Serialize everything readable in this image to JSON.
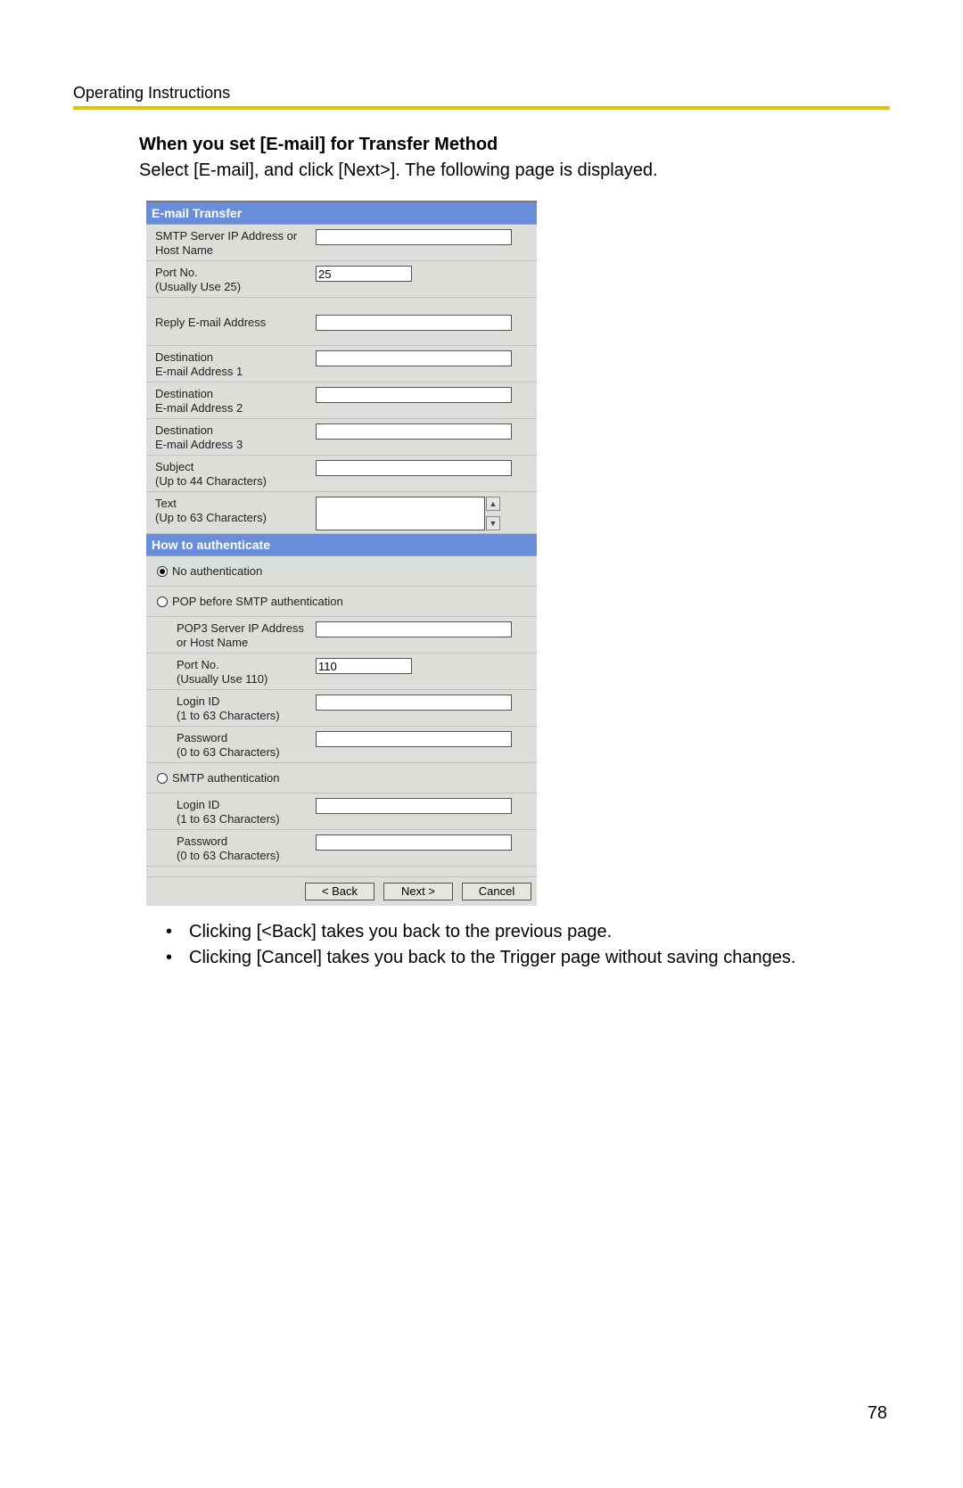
{
  "header": "Operating Instructions",
  "title": "When you set [E-mail] for Transfer Method",
  "description": "Select [E-mail], and click [Next>]. The following page is displayed.",
  "panel1": {
    "header": "E-mail Transfer",
    "smtp_label": "SMTP Server IP Address or Host Name",
    "smtp_value": "",
    "port_label_1": "Port No.",
    "port_label_2": "(Usually Use 25)",
    "port_value": "25",
    "reply_label": "Reply E-mail Address",
    "reply_value": "",
    "dest1_label_1": "Destination",
    "dest1_label_2": "E-mail Address 1",
    "dest1_value": "",
    "dest2_label_1": "Destination",
    "dest2_label_2": "E-mail Address 2",
    "dest2_value": "",
    "dest3_label_1": "Destination",
    "dest3_label_2": "E-mail Address 3",
    "dest3_value": "",
    "subject_label_1": "Subject",
    "subject_label_2": "(Up to 44 Characters)",
    "subject_value": "",
    "text_label_1": "Text",
    "text_label_2": "(Up to 63 Characters)",
    "text_value": ""
  },
  "panel2": {
    "header": "How to authenticate",
    "radio_none": "No authentication",
    "radio_pop": "POP before SMTP authentication",
    "pop3_label_1": "POP3 Server IP Address",
    "pop3_label_2": "or Host Name",
    "pop3_value": "",
    "pop_port_label_1": "Port No.",
    "pop_port_label_2": "(Usually Use 110)",
    "pop_port_value": "110",
    "pop_login_label_1": "Login ID",
    "pop_login_label_2": "(1 to 63 Characters)",
    "pop_login_value": "",
    "pop_pass_label_1": "Password",
    "pop_pass_label_2": "(0 to 63 Characters)",
    "pop_pass_value": "",
    "radio_smtp": "SMTP authentication",
    "smtp_login_label_1": "Login ID",
    "smtp_login_label_2": "(1 to 63 Characters)",
    "smtp_login_value": "",
    "smtp_pass_label_1": "Password",
    "smtp_pass_label_2": "(0 to 63 Characters)",
    "smtp_pass_value": ""
  },
  "buttons": {
    "back": "< Back",
    "next": "Next >",
    "cancel": "Cancel"
  },
  "notes": {
    "n1": "Clicking [<Back] takes you back to the previous page.",
    "n2": "Clicking [Cancel] takes you back to the Trigger page without saving changes."
  },
  "page_number": "78"
}
